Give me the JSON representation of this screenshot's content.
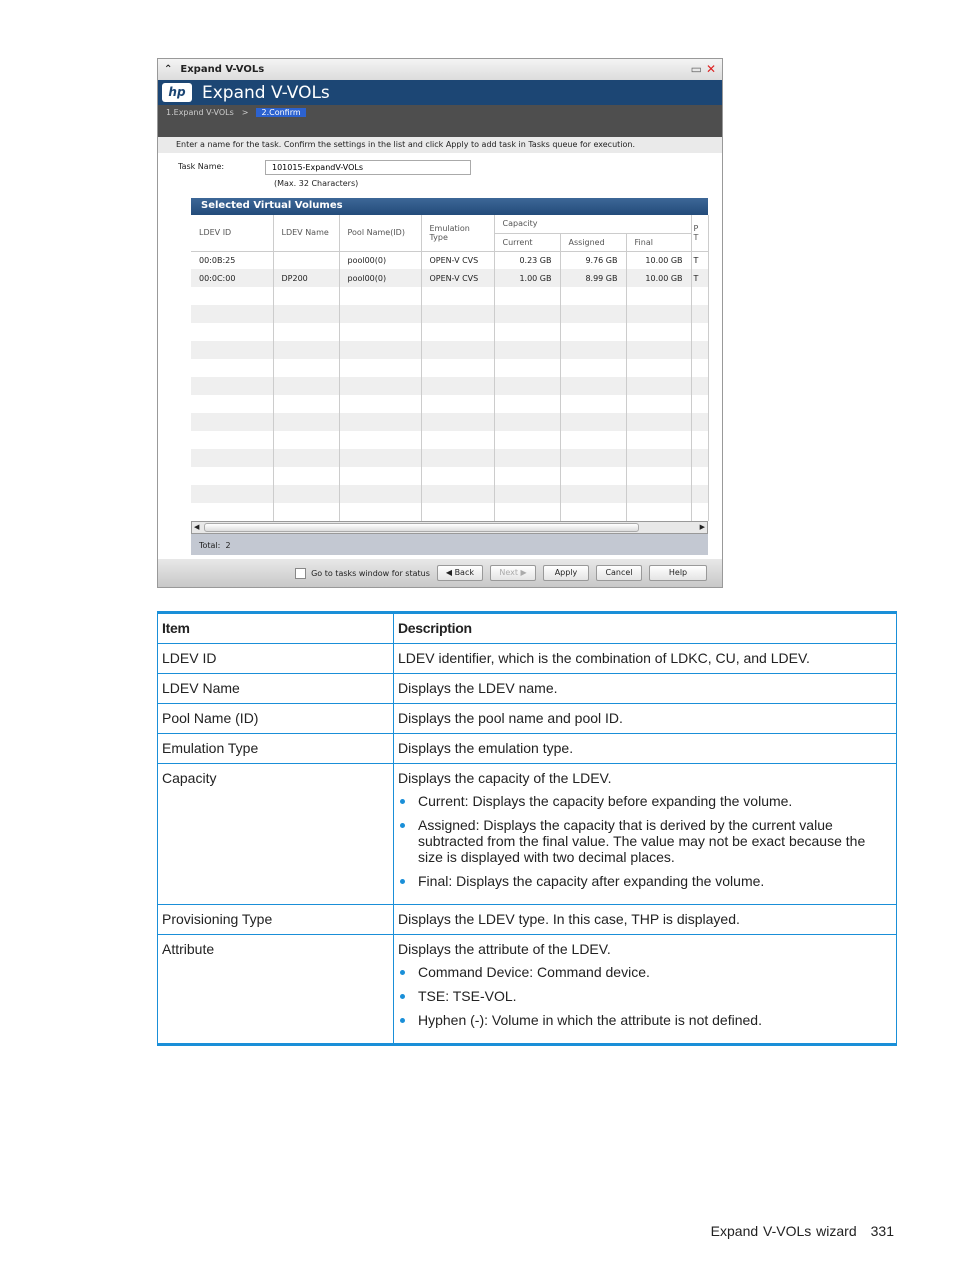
{
  "window": {
    "title": "Expand V-VOLs",
    "banner": "Expand V-VOLs",
    "logo": "hp",
    "steps": [
      "1.Expand V-VOLs",
      ">",
      "2.Confirm"
    ],
    "instruction": "Enter a name for the task. Confirm the settings in the list and click Apply to add task in Tasks queue for execution.",
    "task_label": "Task Name:",
    "task_value": "101015-ExpandV-VOLs",
    "task_hint": "(Max. 32 Characters)",
    "panel_title": "Selected Virtual Volumes",
    "columns": {
      "ldev_id": "LDEV ID",
      "ldev_name": "LDEV Name",
      "pool": "Pool Name(ID)",
      "emulation": "Emulation Type",
      "capacity": "Capacity",
      "current": "Current",
      "assigned": "Assigned",
      "final": "Final",
      "prov": "P T"
    },
    "rows": [
      [
        "00:0B:25",
        "",
        "pool00(0)",
        "OPEN-V CVS",
        "0.23 GB",
        "9.76 GB",
        "10.00 GB",
        "T"
      ],
      [
        "00:0C:00",
        "DP200",
        "pool00(0)",
        "OPEN-V CVS",
        "1.00 GB",
        "8.99 GB",
        "10.00 GB",
        "T"
      ]
    ],
    "total_label": "Total:",
    "total": "2",
    "checkbox_label": "Go to tasks window for status",
    "buttons": {
      "back": "◀ Back",
      "next": "Next ▶",
      "apply": "Apply",
      "cancel": "Cancel",
      "help": "Help"
    }
  },
  "doc_table": {
    "headers": [
      "Item",
      "Description"
    ],
    "rows": [
      {
        "item": "LDEV ID",
        "desc": "LDEV identifier, which is the combination of LDKC, CU, and LDEV.",
        "bullets": []
      },
      {
        "item": "LDEV Name",
        "desc": "Displays the LDEV name.",
        "bullets": []
      },
      {
        "item": "Pool Name (ID)",
        "desc": "Displays the pool name and pool ID.",
        "bullets": []
      },
      {
        "item": "Emulation Type",
        "desc": "Displays the emulation type.",
        "bullets": []
      },
      {
        "item": "Capacity",
        "desc": "Displays the capacity of the LDEV.",
        "bullets": [
          "Current: Displays the capacity before expanding the volume.",
          "Assigned: Displays the capacity that is derived by the current value subtracted from the final value. The value may not be exact because the size is displayed with two decimal places.",
          "Final: Displays the capacity after expanding the volume."
        ]
      },
      {
        "item": "Provisioning Type",
        "desc": "Displays the LDEV type. In this case, THP is displayed.",
        "bullets": []
      },
      {
        "item": "Attribute",
        "desc": "Displays the attribute of the LDEV.",
        "bullets": [
          "Command Device: Command device.",
          "TSE: TSE-VOL.",
          "Hyphen (-): Volume in which the attribute is not defined."
        ]
      }
    ]
  },
  "footer": {
    "section": "Expand V-VOLs wizard",
    "page": "331"
  }
}
